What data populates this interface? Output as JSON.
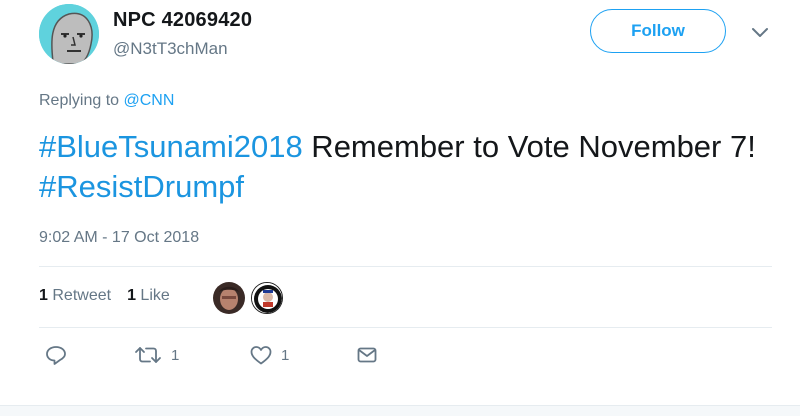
{
  "user": {
    "display_name": "NPC 42069420",
    "handle": "@N3tT3chMan"
  },
  "follow": {
    "label": "Follow"
  },
  "reply": {
    "prefix": "Replying to ",
    "mention": "@CNN"
  },
  "tweet": {
    "hashtag1": "#BlueTsunami2018",
    "text1": " Remember to Vote November 7! ",
    "hashtag2": "#ResistDrumpf"
  },
  "timestamp": "9:02 AM - 17 Oct 2018",
  "stats": {
    "retweets_count": "1",
    "retweets_label": "Retweet",
    "likes_count": "1",
    "likes_label": "Like"
  },
  "actions": {
    "retweet_count": "1",
    "like_count": "1"
  },
  "colors": {
    "accent": "#1da1f2",
    "hashtag": "#1b95e0",
    "muted": "#657786",
    "avatar_bg": "#5fd2dd"
  },
  "icons": [
    "caret-down-icon",
    "reply-icon",
    "retweet-icon",
    "heart-icon",
    "message-icon"
  ]
}
